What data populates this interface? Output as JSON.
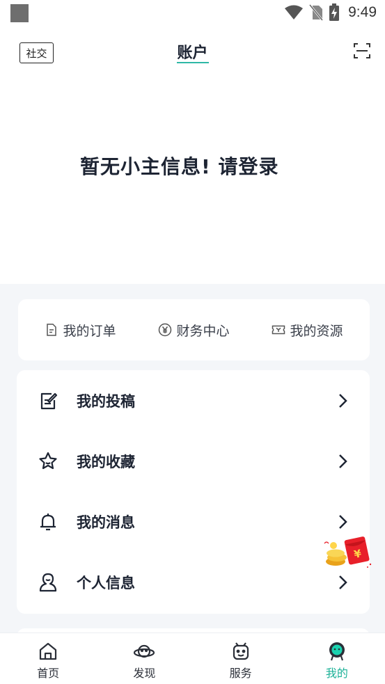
{
  "status_bar": {
    "time": "9:49"
  },
  "header": {
    "social_badge": "社交",
    "title": "账户"
  },
  "hero": {
    "message": "暂无小主信息! 请登录"
  },
  "quick_links": [
    {
      "label": "我的订单",
      "icon": "document-icon"
    },
    {
      "label": "财务中心",
      "icon": "yen-coin-icon"
    },
    {
      "label": "我的资源",
      "icon": "ticket-icon"
    }
  ],
  "menu": [
    {
      "label": "我的投稿",
      "icon": "edit-document-icon"
    },
    {
      "label": "我的收藏",
      "icon": "star-icon"
    },
    {
      "label": "我的消息",
      "icon": "bell-icon"
    },
    {
      "label": "个人信息",
      "icon": "person-icon"
    }
  ],
  "tabbar": [
    {
      "label": "首页",
      "icon": "home-icon",
      "active": false
    },
    {
      "label": "发现",
      "icon": "planet-icon",
      "active": false
    },
    {
      "label": "服务",
      "icon": "robot-icon",
      "active": false
    },
    {
      "label": "我的",
      "icon": "profile-face-icon",
      "active": true
    }
  ],
  "colors": {
    "accent": "#1bb197",
    "text_dark": "#1d2433",
    "background_grey": "#f4f6f9",
    "promo_red": "#e8202a"
  }
}
